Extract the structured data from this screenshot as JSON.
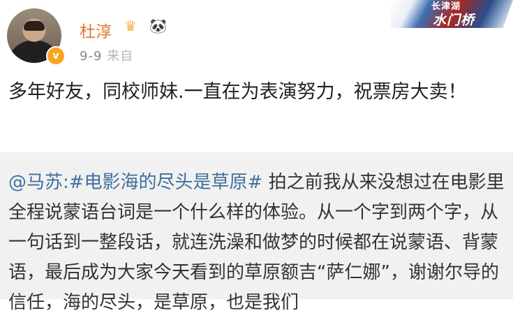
{
  "header": {
    "name": "杜淳",
    "date": "9-9",
    "source_fragment": "来自",
    "verified_badge": "v",
    "icons": [
      "crown-icon",
      "panda-icon"
    ]
  },
  "banner": {
    "line1": "长津湖",
    "line2": "水门桥"
  },
  "post": {
    "text": "多年好友，同校师妹.一直在为表演努力，祝票房大卖！"
  },
  "quote": {
    "mention": "@马苏:",
    "hashtag": "#电影海的尽头是草原#",
    "text": " 拍之前我从来没想过在电影里全程说蒙语台词是一个什么样的体验。从一个字到两个字，从一句话到一整段话，就连洗澡和做梦的时候都在说蒙语、背蒙语，最后成为大家今天看到的草原额吉“萨仁娜”，谢谢尔导的信任，海的尽头，是草原，也是我们"
  },
  "colors": {
    "name": "#e2722d",
    "link": "#3e6f9e",
    "quote_bg": "#f1f1f1",
    "meta": "#8a8a8a"
  }
}
